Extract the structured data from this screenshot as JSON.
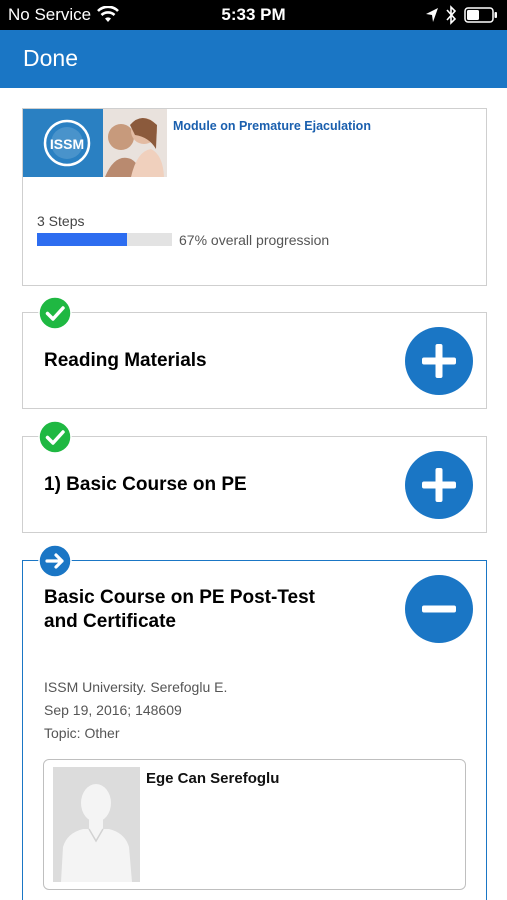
{
  "status_bar": {
    "carrier": "No Service",
    "time": "5:33 PM"
  },
  "nav": {
    "done_label": "Done"
  },
  "module": {
    "title": "Module on Premature Ejaculation",
    "thumbnail_logo_text": "ISSM",
    "steps_label": "3 Steps",
    "progress_fraction": 0.67,
    "progress_text": "67% overall progression"
  },
  "steps": [
    {
      "title": "Reading Materials",
      "status": "completed",
      "toggle_icon": "plus-icon"
    },
    {
      "title": "1) Basic Course on PE",
      "status": "completed",
      "toggle_icon": "plus-icon"
    },
    {
      "title_line1": "Basic Course on PE Post-Test",
      "title_line2": "and Certificate",
      "status": "current",
      "toggle_icon": "minus-icon",
      "author": "ISSM University. Serefoglu E.",
      "date_id": "Sep 19, 2016; 148609",
      "topic": "Topic: Other",
      "instructor": {
        "name": "Ege Can Serefoglu"
      }
    }
  ],
  "colors": {
    "primary": "#1a76c5",
    "progress": "#2d6df0",
    "check_badge": "#1fb842",
    "module_title": "#1a5fae"
  }
}
